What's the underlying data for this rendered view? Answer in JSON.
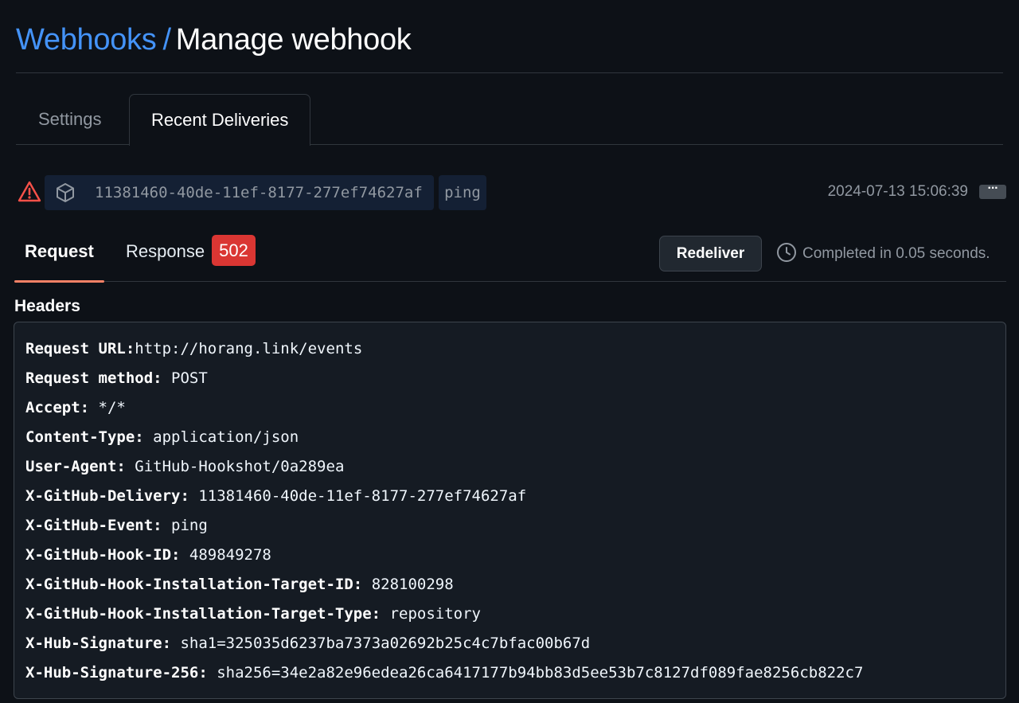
{
  "header": {
    "parent": "Webhooks",
    "separator": "/",
    "current": "Manage webhook"
  },
  "tabs": [
    {
      "label": "Settings",
      "active": false
    },
    {
      "label": "Recent Deliveries",
      "active": true
    }
  ],
  "delivery": {
    "status_icon": "alert-icon",
    "guid_icon": "package-icon",
    "guid": "11381460-40de-11ef-8177-277ef74627af",
    "event": "ping",
    "timestamp": "2024-07-13 15:06:39",
    "more_label": "···"
  },
  "subtabs": {
    "request": "Request",
    "response": "Response",
    "response_status": "502"
  },
  "actions": {
    "redeliver": "Redeliver",
    "completed": "Completed in 0.05 seconds."
  },
  "headers_section": {
    "title": "Headers",
    "rows": [
      {
        "key": "Request URL:",
        "value": "http://horang.link/events"
      },
      {
        "key": "Request method:",
        "value": " POST"
      },
      {
        "key": "Accept:",
        "value": " */*"
      },
      {
        "key": "Content-Type:",
        "value": " application/json"
      },
      {
        "key": "User-Agent:",
        "value": " GitHub-Hookshot/0a289ea"
      },
      {
        "key": "X-GitHub-Delivery:",
        "value": " 11381460-40de-11ef-8177-277ef74627af"
      },
      {
        "key": "X-GitHub-Event:",
        "value": " ping"
      },
      {
        "key": "X-GitHub-Hook-ID:",
        "value": " 489849278"
      },
      {
        "key": "X-GitHub-Hook-Installation-Target-ID:",
        "value": " 828100298"
      },
      {
        "key": "X-GitHub-Hook-Installation-Target-Type:",
        "value": " repository"
      },
      {
        "key": "X-Hub-Signature:",
        "value": " sha1=325035d6237ba7373a02692b25c4c7bfac00b67d"
      },
      {
        "key": "X-Hub-Signature-256:",
        "value": " sha256=34e2a82e96edea26ca6417177b94bb83d5ee53b7c8127df089fae8256cb822c7"
      }
    ]
  },
  "colors": {
    "background": "#0d1117",
    "link": "#4493f8",
    "danger": "#da3633",
    "tab_underline": "#f78166"
  }
}
